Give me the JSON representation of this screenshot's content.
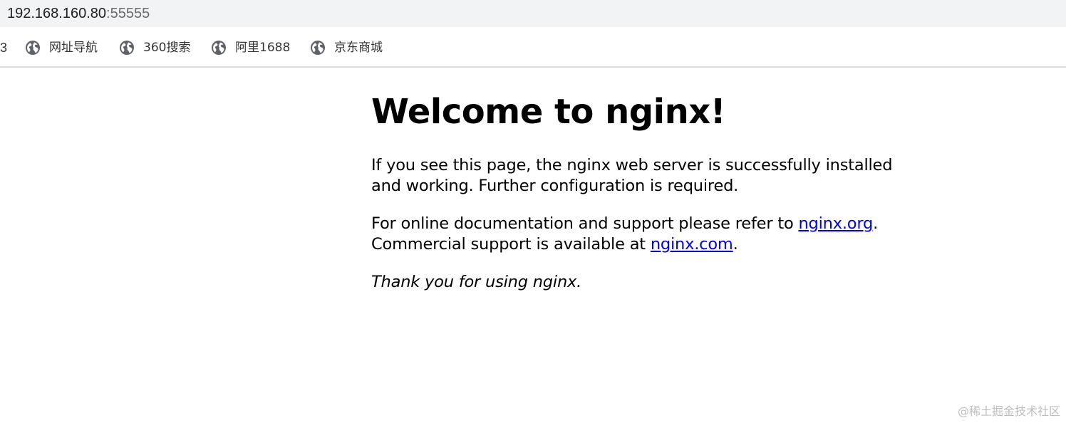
{
  "address_bar": {
    "host": "192.168.160.80",
    "port": ":55555"
  },
  "bookmarks": {
    "partial_label": "3",
    "items": [
      {
        "label": "网址导航",
        "icon": "globe-icon"
      },
      {
        "label": "360搜索",
        "icon": "globe-icon"
      },
      {
        "label": "阿里1688",
        "icon": "globe-icon"
      },
      {
        "label": "京东商城",
        "icon": "globe-icon"
      }
    ]
  },
  "page": {
    "heading": "Welcome to nginx!",
    "intro": "If you see this page, the nginx web server is successfully installed and working. Further configuration is required.",
    "docs_prefix": "For online documentation and support please refer to ",
    "docs_link": "nginx.org",
    "docs_suffix": ".",
    "commercial_prefix": "Commercial support is available at ",
    "commercial_link": "nginx.com",
    "commercial_suffix": ".",
    "thanks": "Thank you for using nginx."
  },
  "watermark": "@稀土掘金技术社区",
  "colors": {
    "link": "#0000ee",
    "toolbar_bg": "#f1f3f4",
    "icon": "#5f6368"
  }
}
